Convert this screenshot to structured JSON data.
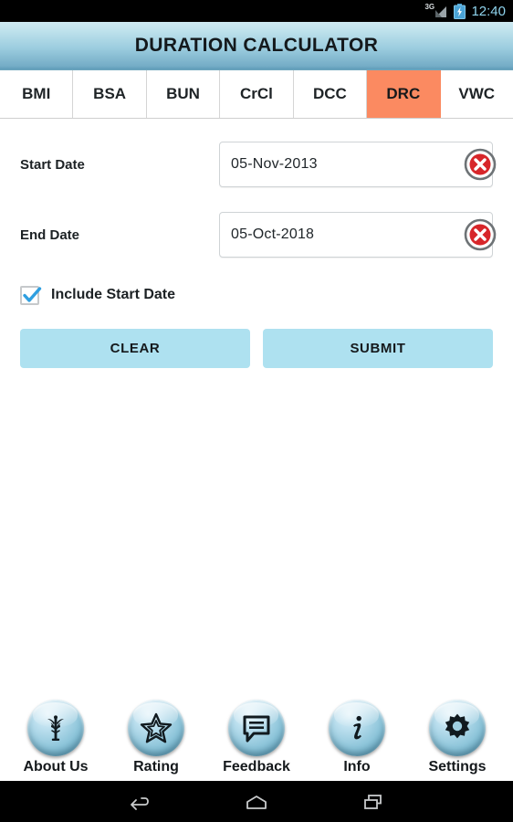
{
  "status_bar": {
    "network_label": "3G",
    "network_icon": "signal-3g-icon",
    "battery_icon": "battery-charging-icon",
    "time": "12:40"
  },
  "header": {
    "title": "DURATION CALCULATOR"
  },
  "tabs": [
    {
      "label": "BMI",
      "active": false
    },
    {
      "label": "BSA",
      "active": false
    },
    {
      "label": "BUN",
      "active": false
    },
    {
      "label": "CrCl",
      "active": false
    },
    {
      "label": "DCC",
      "active": false
    },
    {
      "label": "DRC",
      "active": true
    },
    {
      "label": "VWC",
      "active": false
    }
  ],
  "form": {
    "start_date": {
      "label": "Start Date",
      "value": "05-Nov-2013",
      "clear_icon": "clear-circle-icon"
    },
    "end_date": {
      "label": "End Date",
      "value": "05-Oct-2018",
      "clear_icon": "clear-circle-icon"
    },
    "include_start_date": {
      "label": "Include Start Date",
      "checked": true
    },
    "clear_button": "CLEAR",
    "submit_button": "SUBMIT"
  },
  "bottom_nav": [
    {
      "label": "About Us",
      "icon": "caduceus-icon"
    },
    {
      "label": "Rating",
      "icon": "star-icon"
    },
    {
      "label": "Feedback",
      "icon": "speech-bubble-icon"
    },
    {
      "label": "Info",
      "icon": "info-i-icon"
    },
    {
      "label": "Settings",
      "icon": "gear-icon"
    }
  ],
  "android_nav": {
    "back": "back-arrow-icon",
    "home": "home-icon",
    "recents": "recents-icon"
  },
  "colors": {
    "accent_tab_active": "#fb8a61",
    "header_gradient_top": "#cfe9f1",
    "header_gradient_bottom": "#5f9db9",
    "button_fill": "#aee1f0",
    "clear_red": "#d7262a",
    "checkbox_blue": "#2f9fe0",
    "status_time": "#8fd4ee"
  }
}
